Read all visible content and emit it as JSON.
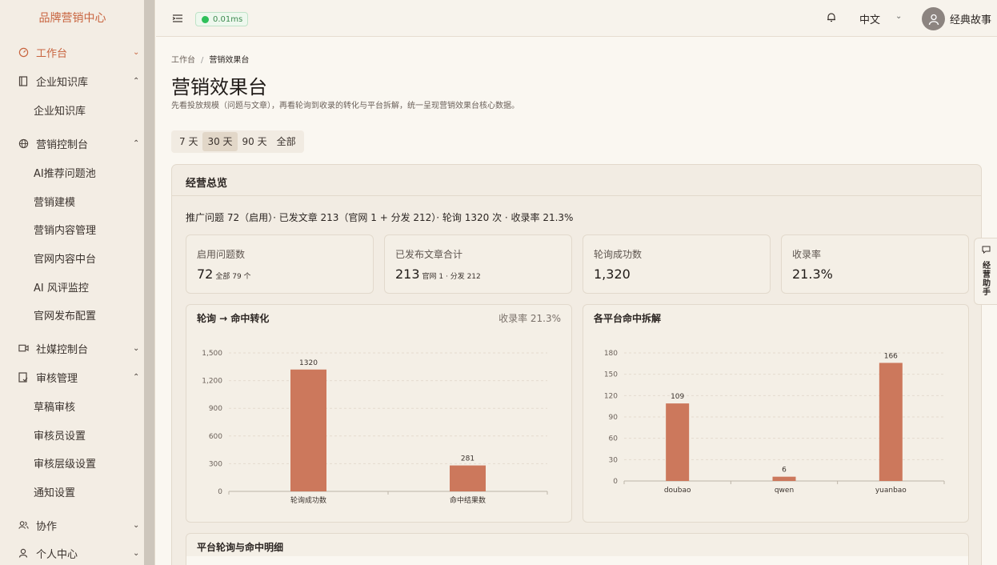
{
  "sidebar": {
    "brand": "品牌营销中心",
    "items": [
      {
        "label": "工作台",
        "icon": "dashboard-icon"
      },
      {
        "label": "企业知识库",
        "icon": "book-icon"
      },
      {
        "label": "营销控制台",
        "icon": "globe-icon"
      },
      {
        "label": "社媒控制台",
        "icon": "video-icon"
      },
      {
        "label": "审核管理",
        "icon": "audit-icon"
      },
      {
        "label": "协作",
        "icon": "team-icon"
      },
      {
        "label": "个人中心",
        "icon": "user-icon"
      }
    ],
    "subs": {
      "knowledge": [
        "企业知识库"
      ],
      "marketing": [
        "AI推荐问题池",
        "营销建模",
        "营销内容管理",
        "官网内容中台",
        "AI 风评监控",
        "官网发布配置"
      ],
      "audit": [
        "草稿审核",
        "审核员设置",
        "审核层级设置",
        "通知设置"
      ]
    }
  },
  "topbar": {
    "ping": "0.01ms",
    "lang": "中文",
    "username": "经典故事"
  },
  "breadcrumb": {
    "root": "工作台",
    "sep": "/",
    "current": "营销效果台"
  },
  "page": {
    "title": "营销效果台",
    "desc": "先看投放规模（问题与文章），再看轮询到收录的转化与平台拆解，统一呈现营销效果台核心数据。"
  },
  "ranges": [
    "7 天",
    "30 天",
    "90 天",
    "全部"
  ],
  "range_selected": "30 天",
  "overview": {
    "title": "经营总览",
    "summary": "推广问题 72（启用）· 已发文章 213（官网 1 + 分发 212）· 轮询 1320 次 · 收录率 21.3%"
  },
  "kpis": [
    {
      "label": "启用问题数",
      "value": "72",
      "sub": "全部 79 个"
    },
    {
      "label": "已发布文章合计",
      "value": "213",
      "sub": "官网 1 · 分发 212"
    },
    {
      "label": "轮询成功数",
      "value": "1,320",
      "sub": ""
    },
    {
      "label": "收录率",
      "value": "21.3%",
      "sub": ""
    }
  ],
  "chart1_title": "轮询 → 命中转化",
  "chart1_right": "收录率 21.3%",
  "chart2_title": "各平台命中拆解",
  "table_title": "平台轮询与命中明细",
  "assistant": {
    "label": "经营助手"
  },
  "colors": {
    "accent": "#c8643f",
    "bar": "#cc785c"
  },
  "chart_data": [
    {
      "type": "bar",
      "title": "轮询 → 命中转化",
      "categories": [
        "轮询成功数",
        "命中结果数"
      ],
      "values": [
        1320,
        281
      ],
      "yticks": [
        "0",
        "300",
        "600",
        "900",
        "1,200",
        "1,500"
      ],
      "ylim": [
        0,
        1500
      ]
    },
    {
      "type": "bar",
      "title": "各平台命中拆解",
      "categories": [
        "doubao",
        "qwen",
        "yuanbao"
      ],
      "values": [
        109,
        6,
        166
      ],
      "yticks": [
        "0",
        "30",
        "60",
        "90",
        "120",
        "150",
        "180"
      ],
      "ylim": [
        0,
        180
      ]
    }
  ]
}
